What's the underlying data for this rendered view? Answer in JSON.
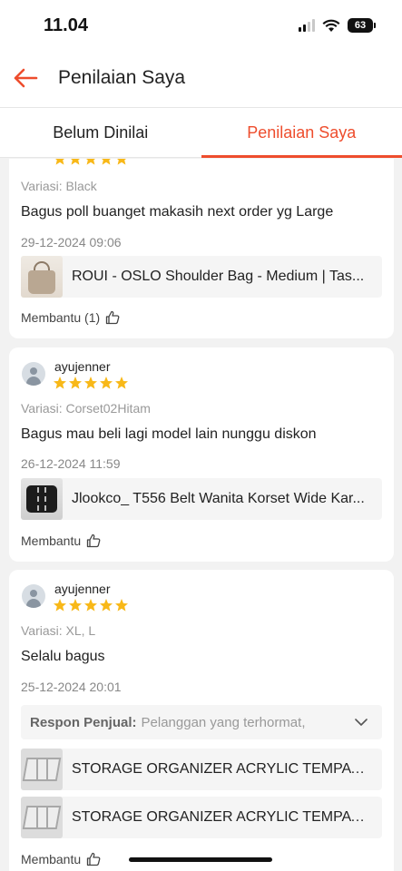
{
  "status_bar": {
    "time": "11.04",
    "battery": "63"
  },
  "header": {
    "title": "Penilaian Saya"
  },
  "tabs": [
    {
      "label": "Belum Dinilai",
      "active": false
    },
    {
      "label": "Penilaian Saya",
      "active": true
    }
  ],
  "colors": {
    "accent": "#ee4d2d",
    "star": "#f8b818"
  },
  "reviews": [
    {
      "username": "",
      "rating": 5,
      "variation": "Variasi: Black",
      "text": "Bagus poll buanget makasih next order yg Large",
      "date": "29-12-2024 09:06",
      "products": [
        {
          "name": "ROUI - OSLO Shoulder Bag - Medium | Tas...",
          "thumb": "bag"
        }
      ],
      "helpful_label": "Membantu (1)"
    },
    {
      "username": "ayujenner",
      "rating": 5,
      "variation": "Variasi: Corset02Hitam",
      "text": "Bagus mau beli lagi model lain nunggu diskon",
      "date": "26-12-2024 11:59",
      "products": [
        {
          "name": "Jlookco_ T556 Belt Wanita Korset Wide Kar...",
          "thumb": "belt"
        }
      ],
      "helpful_label": "Membantu"
    },
    {
      "username": "ayujenner",
      "rating": 5,
      "variation": "Variasi: XL, L",
      "text": "Selalu bagus",
      "date": "25-12-2024 20:01",
      "seller_response": {
        "label": "Respon Penjual:",
        "text": "Pelanggan yang terhormat,"
      },
      "products": [
        {
          "name": "STORAGE ORGANIZER ACRYLIC TEMPAT P...",
          "thumb": "box"
        },
        {
          "name": "STORAGE ORGANIZER ACRYLIC TEMPAT P...",
          "thumb": "box"
        }
      ],
      "helpful_label": "Membantu"
    }
  ]
}
